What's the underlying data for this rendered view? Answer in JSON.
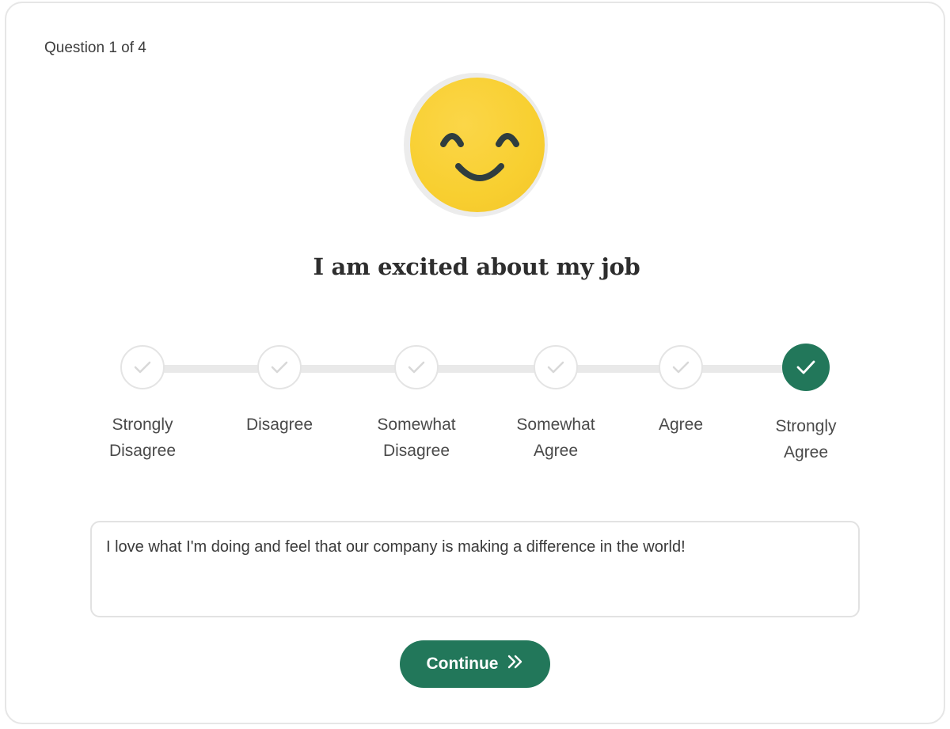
{
  "survey": {
    "progress_text": "Question 1 of 4",
    "emoji_icon": "smiling-face-icon",
    "question": "I am excited about my job",
    "scale": {
      "options": [
        {
          "line1": "Strongly",
          "line2": "Disagree",
          "selected": false
        },
        {
          "line1": "Disagree",
          "line2": "",
          "selected": false
        },
        {
          "line1": "Somewhat",
          "line2": "Disagree",
          "selected": false
        },
        {
          "line1": "Somewhat",
          "line2": "Agree",
          "selected": false
        },
        {
          "line1": "Agree",
          "line2": "",
          "selected": false
        },
        {
          "line1": "Strongly",
          "line2": "Agree",
          "selected": true
        }
      ]
    },
    "comment": {
      "value": "I love what I'm doing and feel that our company is making a difference in the world!"
    },
    "continue_label": "Continue",
    "continue_icon": "double-chevron-right-icon"
  },
  "colors": {
    "accent": "#22775a",
    "emoji": "#f8cf30",
    "check_inactive": "#d8d8d8"
  }
}
